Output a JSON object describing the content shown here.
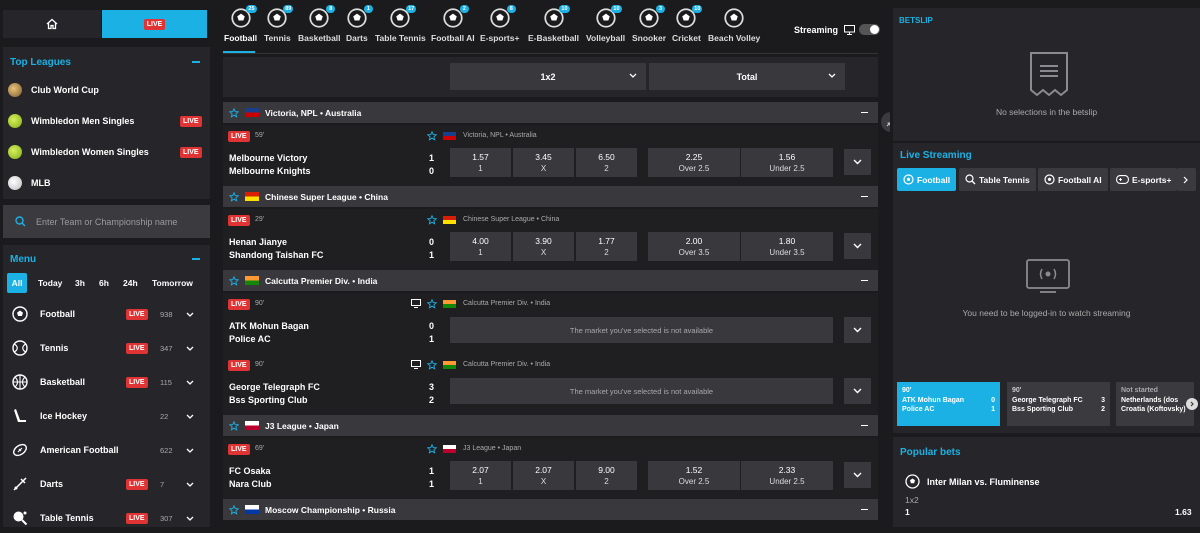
{
  "left": {
    "live_label": "LIVE",
    "top_leagues_title": "Top Leagues",
    "top_leagues": [
      {
        "name": "Club World Cup",
        "live": false
      },
      {
        "name": "Wimbledon Men Singles",
        "live": true
      },
      {
        "name": "Wimbledon Women Singles",
        "live": true
      },
      {
        "name": "MLB",
        "live": false
      }
    ],
    "search_placeholder": "Enter Team or Championship name",
    "menu_title": "Menu",
    "time_filters": [
      "All",
      "Today",
      "3h",
      "6h",
      "24h",
      "Tomorrow"
    ],
    "sports": [
      {
        "name": "Football",
        "live": true,
        "count": "938",
        "icon": "football-icon"
      },
      {
        "name": "Tennis",
        "live": true,
        "count": "347",
        "icon": "tennis-icon"
      },
      {
        "name": "Basketball",
        "live": true,
        "count": "115",
        "icon": "basketball-icon"
      },
      {
        "name": "Ice Hockey",
        "live": false,
        "count": "22",
        "icon": "ice-hockey-icon"
      },
      {
        "name": "American Football",
        "live": false,
        "count": "622",
        "icon": "american-football-icon"
      },
      {
        "name": "Darts",
        "live": true,
        "count": "7",
        "icon": "darts-icon"
      },
      {
        "name": "Table Tennis",
        "live": true,
        "count": "307",
        "icon": "table-tennis-icon"
      }
    ]
  },
  "center": {
    "sport_tabs": [
      {
        "label": "Football",
        "count": "25",
        "active": true
      },
      {
        "label": "Tennis",
        "count": "89"
      },
      {
        "label": "Basketball",
        "count": "8"
      },
      {
        "label": "Darts",
        "count": "1"
      },
      {
        "label": "Table Tennis",
        "count": "17"
      },
      {
        "label": "Football AI",
        "count": "2"
      },
      {
        "label": "E-sports+",
        "count": "8"
      },
      {
        "label": "E-Basketball",
        "count": "10"
      },
      {
        "label": "Volleyball",
        "count": "10"
      },
      {
        "label": "Snooker",
        "count": "3"
      },
      {
        "label": "Cricket",
        "count": "10"
      },
      {
        "label": "Beach Volley",
        "count": ""
      }
    ],
    "streaming_label": "Streaming",
    "market_dropdown": "1x2",
    "total_dropdown": "Total",
    "na_text": "The market you've selected is not available",
    "leagues": [
      {
        "title": "Victoria, NPL • Australia",
        "matches": [
          {
            "minute": "59'",
            "league": "Victoria, NPL • Australia",
            "team1": "Melbourne Victory",
            "team2": "Melbourne Knights",
            "score1": "1",
            "score2": "0",
            "odds": [
              {
                "v": "1.57",
                "l": "1"
              },
              {
                "v": "3.45",
                "l": "X"
              },
              {
                "v": "6.50",
                "l": "2"
              }
            ],
            "totals": [
              {
                "v": "2.25",
                "l": "Over 2.5"
              },
              {
                "v": "1.56",
                "l": "Under 2.5"
              }
            ]
          }
        ]
      },
      {
        "title": "Chinese Super League • China",
        "matches": [
          {
            "minute": "29'",
            "league": "Chinese Super League • China",
            "team1": "Henan Jianye",
            "team2": "Shandong Taishan FC",
            "score1": "0",
            "score2": "1",
            "odds": [
              {
                "v": "4.00",
                "l": "1"
              },
              {
                "v": "3.90",
                "l": "X"
              },
              {
                "v": "1.77",
                "l": "2"
              }
            ],
            "totals": [
              {
                "v": "2.00",
                "l": "Over 3.5"
              },
              {
                "v": "1.80",
                "l": "Under 3.5"
              }
            ]
          }
        ]
      },
      {
        "title": "Calcutta Premier Div. • India",
        "matches": [
          {
            "minute": "90'",
            "league": "Calcutta Premier Div. • India",
            "team1": "ATK Mohun Bagan",
            "team2": "Police AC",
            "score1": "0",
            "score2": "1"
          },
          {
            "minute": "90'",
            "league": "Calcutta Premier Div. • India",
            "team1": "George Telegraph FC",
            "team2": "Bss Sporting Club",
            "score1": "3",
            "score2": "2"
          }
        ]
      },
      {
        "title": "J3 League • Japan",
        "matches": [
          {
            "minute": "69'",
            "league": "J3 League • Japan",
            "team1": "FC Osaka",
            "team2": "Nara Club",
            "score1": "1",
            "score2": "1",
            "odds": [
              {
                "v": "2.07",
                "l": "1"
              },
              {
                "v": "2.07",
                "l": "X"
              },
              {
                "v": "9.00",
                "l": "2"
              }
            ],
            "totals": [
              {
                "v": "1.52",
                "l": "Over 2.5"
              },
              {
                "v": "2.33",
                "l": "Under 2.5"
              }
            ]
          }
        ]
      },
      {
        "title": "Moscow Championship • Russia",
        "matches": []
      }
    ]
  },
  "right": {
    "betslip_title": "BETSLIP",
    "betslip_empty": "No selections in the betslip",
    "live_streaming_title": "Live Streaming",
    "stream_tabs": [
      "Football",
      "Table Tennis",
      "Football AI",
      "E-sports+"
    ],
    "login_msg": "You need to be logged-in to watch streaming",
    "cards": [
      {
        "status": "90'",
        "team1": "ATK Mohun Bagan",
        "team2": "Police AC",
        "s1": "0",
        "s2": "1"
      },
      {
        "status": "90'",
        "team1": "George Telegraph FC",
        "team2": "Bss Sporting Club",
        "s1": "3",
        "s2": "2"
      },
      {
        "status": "Not started",
        "team1": "Netherlands (dos",
        "team2": "Croatia (Koftovsky)",
        "s1": "",
        "s2": ""
      }
    ],
    "popular_title": "Popular bets",
    "popular_match": "Inter Milan vs. Fluminense",
    "popular_market": "1x2",
    "popular_sel": "1",
    "popular_odd": "1.63"
  },
  "colors": {
    "accent": "#1bb1e4",
    "live": "#e03434",
    "panel": "#26262a",
    "bg": "#1b1b1d"
  }
}
